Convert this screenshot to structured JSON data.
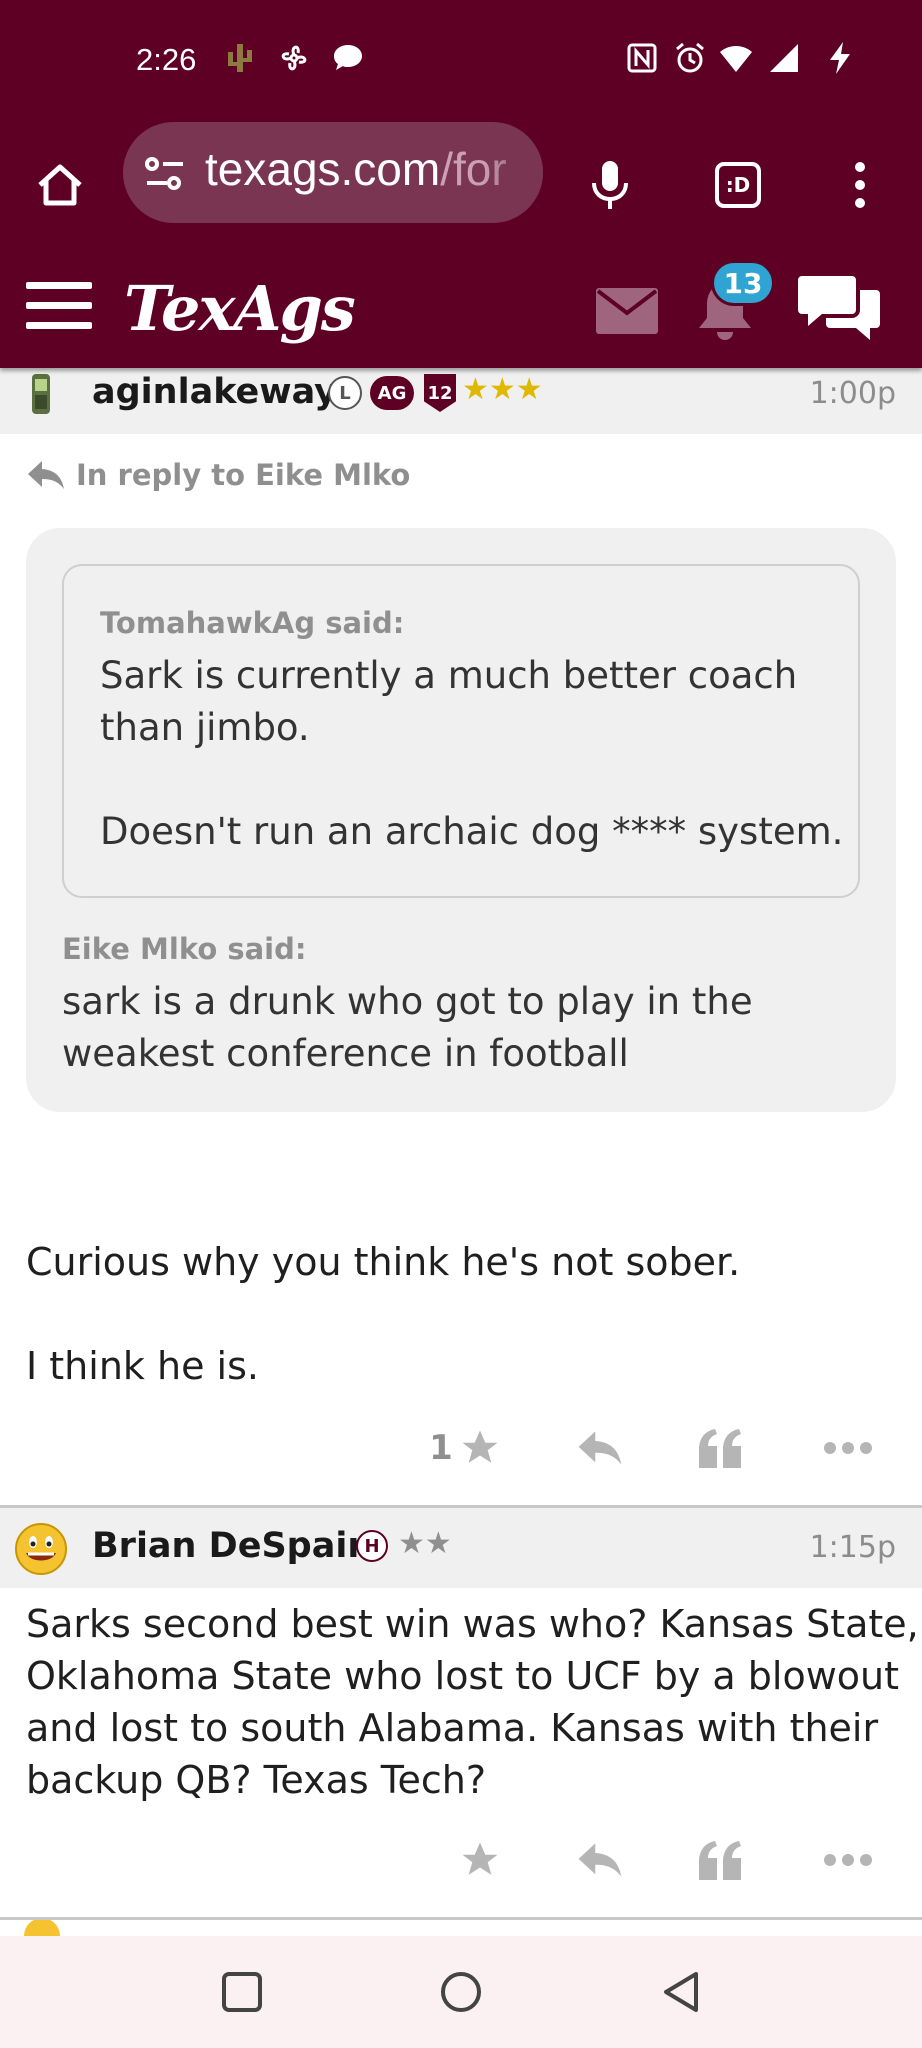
{
  "status_bar": {
    "time": "2:26"
  },
  "browser": {
    "url_visible": "texags.com/for",
    "url_host": "texags.com",
    "url_path": "/for",
    "tab_icon_label": ":D"
  },
  "site": {
    "logo": "TexAgs",
    "notification_count": "13",
    "brand_color": "#5e0024"
  },
  "posts": [
    {
      "username": "aginlakeway",
      "time": "1:00p",
      "ranks": [
        "L",
        "AG",
        "12"
      ],
      "stars": "★★★",
      "reply_to": "In reply to Eike Mlko",
      "inner_quote": {
        "author": "TomahawkAg said:",
        "text_1": "Sark is currently a much better coach",
        "text_2": "than jimbo.",
        "text_3": "Doesn't run an archaic dog **** system."
      },
      "outer_quote": {
        "author": "Eike Mlko said:",
        "text_1": "sark is a drunk who got to play in the",
        "text_2": "weakest conference in football"
      },
      "body_1": "Curious why you think he's not sober.",
      "body_2": "I think he is.",
      "star_count": "1"
    },
    {
      "username": "Brian DeSpain",
      "time": "1:15p",
      "ranks": [
        "H"
      ],
      "stars": "★★",
      "body_1": "Sarks second best win was who? Kansas State,",
      "body_2": "Oklahoma State who lost to UCF by a blowout",
      "body_3": "and lost to south Alabama. Kansas with their",
      "body_4": "backup QB? Texas Tech?"
    }
  ]
}
